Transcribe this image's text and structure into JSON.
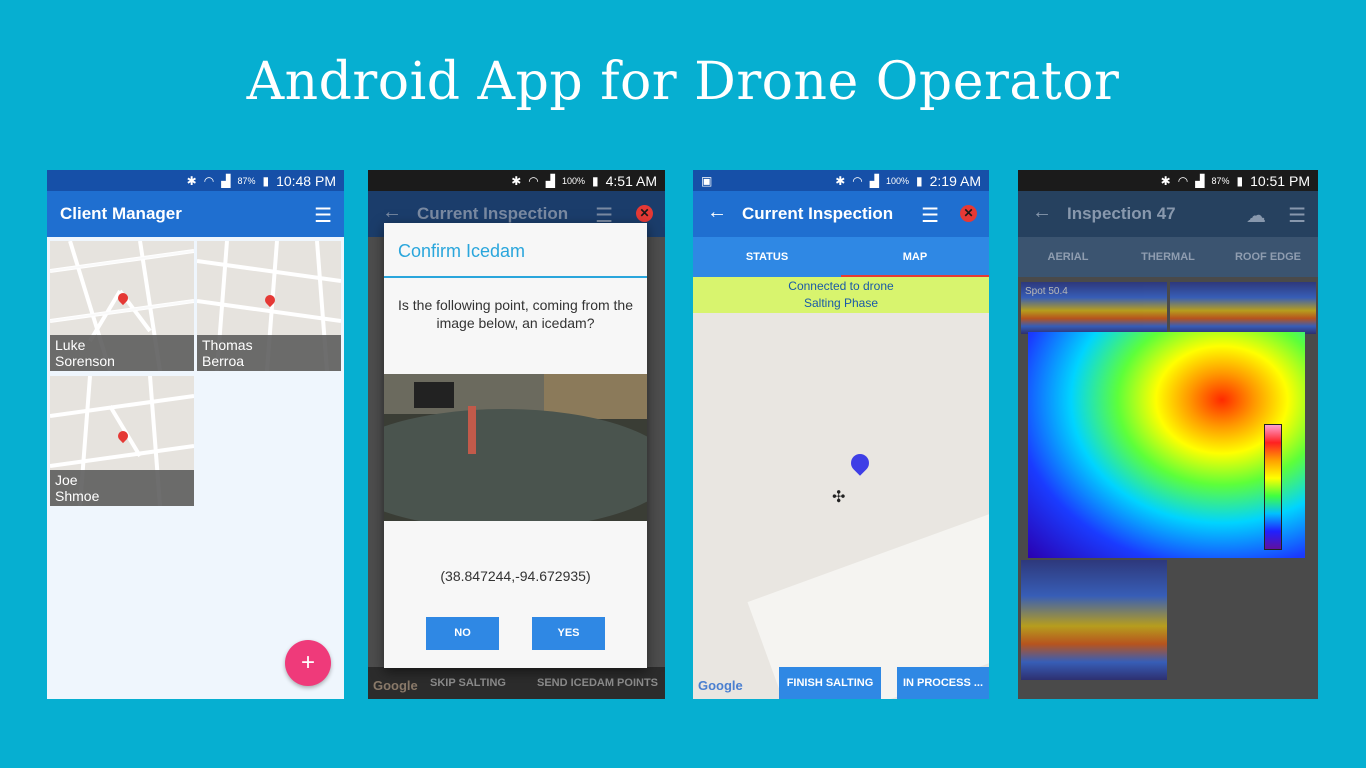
{
  "headline": "Android App for Drone Operator",
  "phone1": {
    "status": {
      "battery": "87%",
      "time": "10:48 PM"
    },
    "title": "Client Manager",
    "clients": [
      {
        "first": "Luke",
        "last": "Sorenson"
      },
      {
        "first": "Thomas",
        "last": "Berroa"
      },
      {
        "first": "Joe",
        "last": "Shmoe"
      }
    ],
    "fab": "+"
  },
  "phone2": {
    "status": {
      "battery": "100%",
      "time": "4:51 AM"
    },
    "title": "Current Inspection",
    "dialog": {
      "title": "Confirm Icedam",
      "question": "Is the following point, coming from the image below, an icedam?",
      "coords": "(38.847244,-94.672935)",
      "no": "NO",
      "yes": "YES"
    },
    "google": "Google",
    "skip": "SKIP SALTING",
    "send": "SEND ICEDAM POINTS"
  },
  "phone3": {
    "status": {
      "battery": "100%",
      "time": "2:19 AM"
    },
    "title": "Current Inspection",
    "tabs": [
      "STATUS",
      "MAP"
    ],
    "banner1": "Connected to drone",
    "banner2": "Salting Phase",
    "google": "Google",
    "finish": "FINISH SALTING",
    "inprocess": "IN PROCESS ..."
  },
  "phone4": {
    "status": {
      "battery": "87%",
      "time": "10:51 PM"
    },
    "title": "Inspection 47",
    "tabs": [
      "AERIAL",
      "THERMAL",
      "ROOF EDGE"
    ],
    "spot": "Spot 50.4"
  },
  "colors": {
    "background": "#06afd1",
    "appbar": "#1f6fd0",
    "accent": "#2f88e4",
    "fab": "#ef3a7a"
  }
}
